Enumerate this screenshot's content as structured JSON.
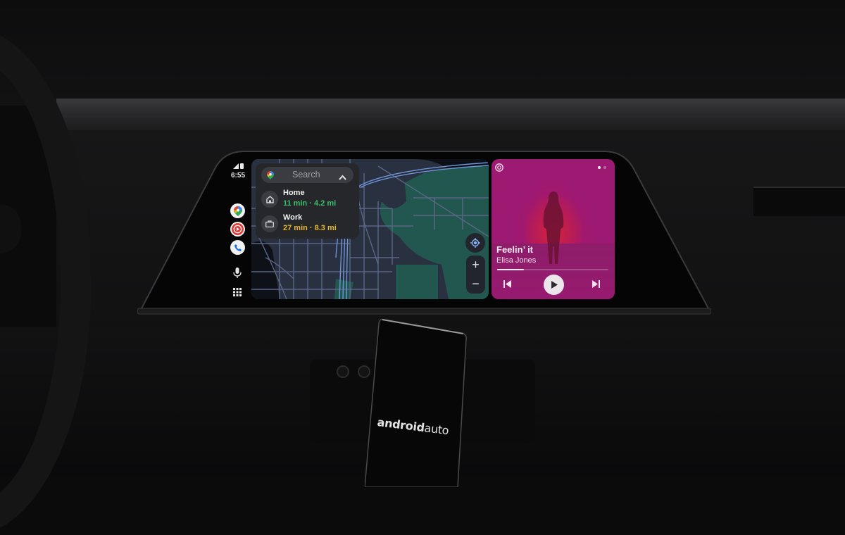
{
  "status_bar": {
    "time": "6:55",
    "signal_icon": "cell-signal-icon",
    "battery_icon": "battery-icon"
  },
  "app_rail": {
    "apps": [
      {
        "name": "Google Maps",
        "icon": "google-maps-icon"
      },
      {
        "name": "YouTube Music",
        "icon": "youtube-music-icon"
      },
      {
        "name": "Phone",
        "icon": "phone-icon"
      }
    ],
    "voice_icon": "microphone-icon",
    "launcher_icon": "app-grid-icon"
  },
  "navigation": {
    "search_placeholder": "Search",
    "collapse_icon": "chevron-up-icon",
    "destinations": [
      {
        "label": "Home",
        "eta": "11 min · 4.2 mi",
        "icon": "home-icon",
        "eta_color": "#3fbf6a"
      },
      {
        "label": "Work",
        "eta": "27 min · 8.3 mi",
        "icon": "briefcase-icon",
        "eta_color": "#e6b72f"
      }
    ],
    "map_controls": {
      "recenter_icon": "my-location-icon",
      "zoom_in_label": "+",
      "zoom_out_label": "−"
    }
  },
  "media": {
    "source_icon": "media-source-icon",
    "song_title": "Feelin’ it",
    "artist": "Elisa Jones",
    "progress_percent": 24,
    "page_indicator": {
      "pages": 2,
      "active": 0
    },
    "controls": {
      "previous": "skip-previous-icon",
      "play": "play-icon",
      "next": "skip-next-icon"
    },
    "accent_color": "#9d1a72"
  },
  "phone": {
    "brand_bold": "android",
    "brand_light": "auto"
  }
}
